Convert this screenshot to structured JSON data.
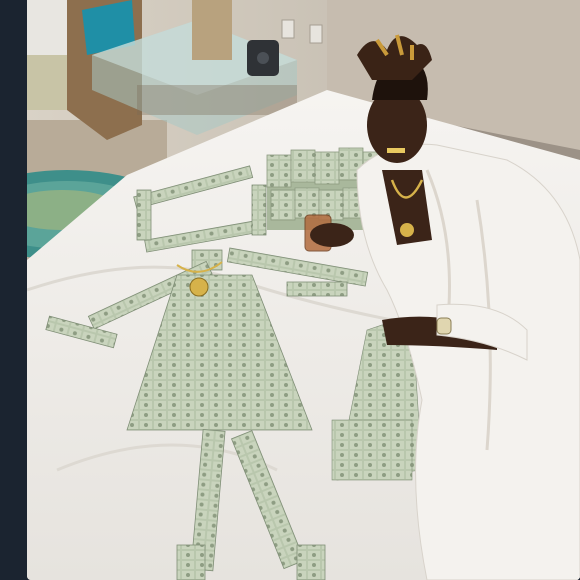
{
  "photo": {
    "subject": "money-figure-on-bed",
    "colors": {
      "page_background": "#1b2430",
      "wall": "#c9c2b6",
      "bedsheet": "#f1efeb",
      "banknote": "#b9c7ad",
      "robe": "#f4f2ee",
      "rug": "#3e8f8a"
    }
  }
}
